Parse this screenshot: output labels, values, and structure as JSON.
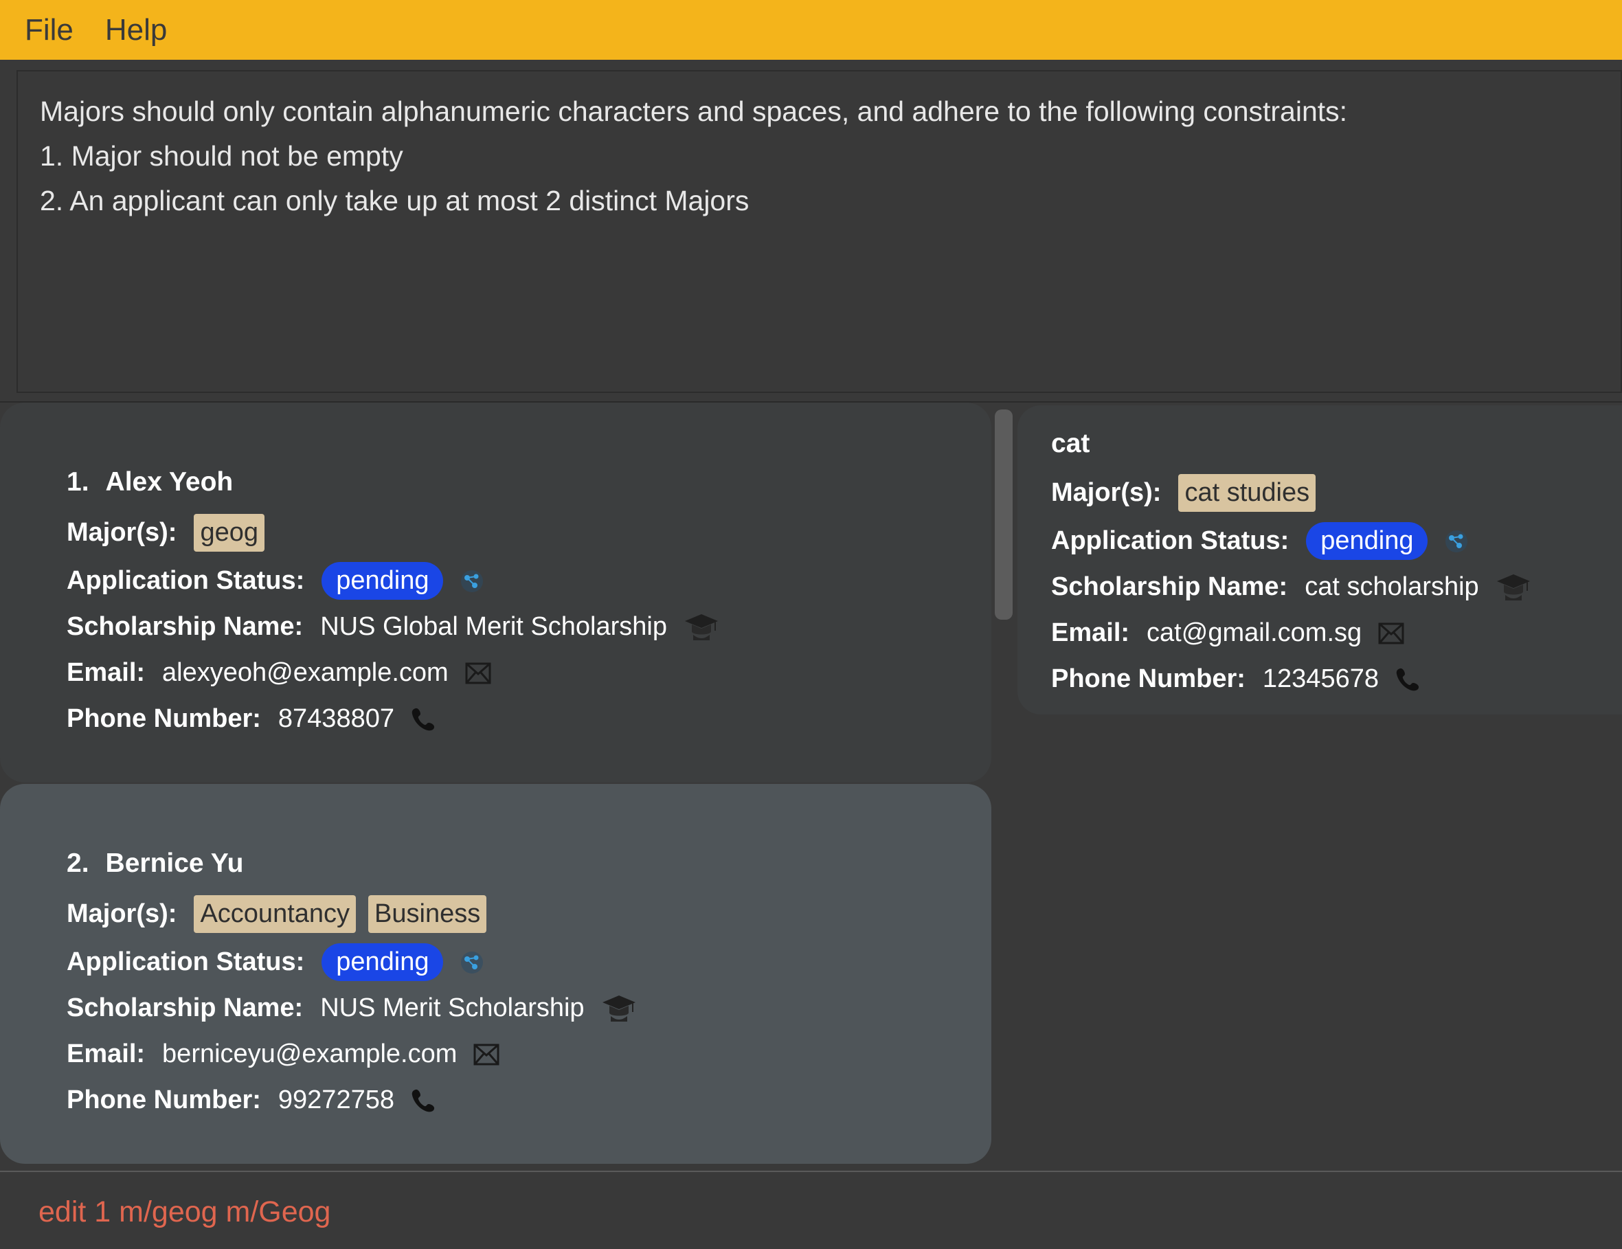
{
  "menu": {
    "items": [
      "File",
      "Help"
    ]
  },
  "result": {
    "lines": [
      "Majors should only contain alphanumeric characters and spaces, and adhere to the following constraints:",
      "1. Major should not be empty",
      "2. An applicant can only take up at most 2 distinct Majors"
    ]
  },
  "labels": {
    "major": "Major(s):",
    "status": "Application Status:",
    "scholarship": "Scholarship Name:",
    "email": "Email:",
    "phone": "Phone Number:"
  },
  "icons": {
    "status": "network-nodes-icon",
    "scholarship": "graduation-cap-icon",
    "email": "envelope-icon",
    "phone": "phone-icon"
  },
  "colors": {
    "menubar": "#f4b41b",
    "status_pill": "#1a46e6",
    "major_tag": "#d8c4a0",
    "command_text": "#e0664f"
  },
  "applicants": [
    {
      "index": "1.",
      "name": "Alex Yeoh",
      "majors": [
        "geog"
      ],
      "status": "pending",
      "scholarship": "NUS Global Merit Scholarship",
      "email": "alexyeoh@example.com",
      "phone": "87438807"
    },
    {
      "index": "2.",
      "name": "Bernice Yu",
      "majors": [
        "Accountancy",
        "Business"
      ],
      "status": "pending",
      "scholarship": "NUS Merit Scholarship",
      "email": "berniceyu@example.com",
      "phone": "99272758"
    }
  ],
  "detail": {
    "name": "cat",
    "majors": [
      "cat studies"
    ],
    "status": "pending",
    "scholarship": "cat scholarship",
    "email": "cat@gmail.com.sg",
    "phone": "12345678"
  },
  "command": {
    "value": "edit 1 m/geog m/Geog"
  }
}
